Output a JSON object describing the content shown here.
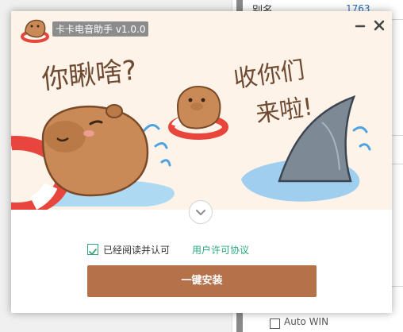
{
  "background_app": {
    "row_label": "别名",
    "row_value": "1763",
    "bottom_text": "Auto WIN"
  },
  "window": {
    "title": "卡卡电音助手 v1.0.0",
    "minimize_icon": "minimize-icon",
    "close_icon": "close-icon"
  },
  "banner": {
    "left_slogan": "你瞅啥?",
    "right_slogan_line1": "收你们",
    "right_slogan_line2": "来啦!",
    "colors": {
      "background": "#fdf3e8",
      "capybara": "#c98a57",
      "shark": "#7d8a96",
      "water": "#8ec7f0"
    }
  },
  "expand_icon": "chevron-down-icon",
  "agreement": {
    "checked": true,
    "label": "已经阅读并认可",
    "link": "用户许可协议"
  },
  "install_button": {
    "label": "一键安装",
    "color": "#b5714a"
  }
}
